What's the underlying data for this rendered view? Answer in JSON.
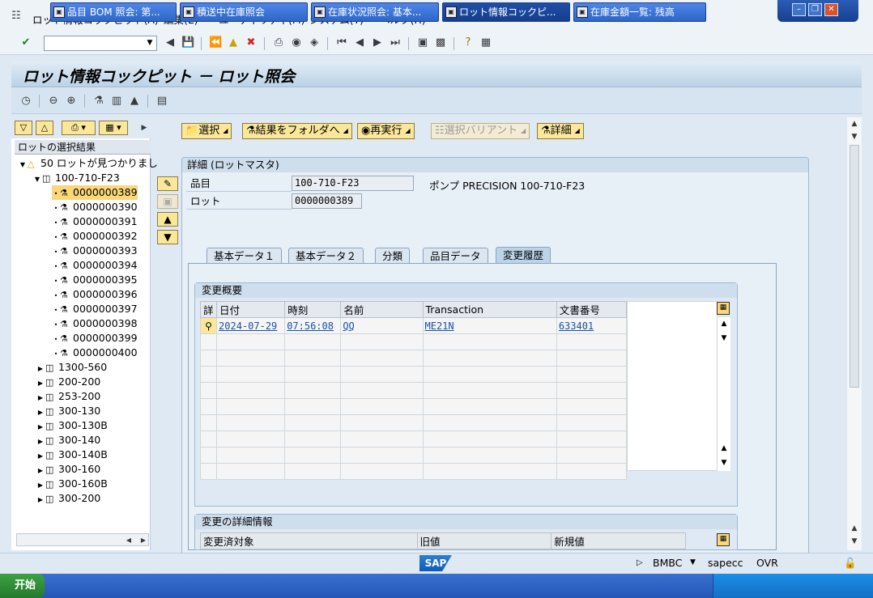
{
  "menu": {
    "items": [
      "ロット情報コックピット(A)",
      "編集(E)",
      "ユーティリティ(M)",
      "システム(Y)",
      "ヘルプ(H)"
    ]
  },
  "title": "ロット情報コックピット － ロット照会",
  "left_panel": {
    "header": "ロットの選択結果",
    "summary": "50 ロットが見つかりまし",
    "material_open": "100-710-F23",
    "lots": [
      "0000000389",
      "0000000390",
      "0000000391",
      "0000000392",
      "0000000393",
      "0000000394",
      "0000000395",
      "0000000396",
      "0000000397",
      "0000000398",
      "0000000399",
      "0000000400"
    ],
    "other_materials": [
      "1300-560",
      "200-200",
      "253-200",
      "300-130",
      "300-130B",
      "300-140",
      "300-140B",
      "300-160",
      "300-160B",
      "300-200"
    ]
  },
  "toolbar": {
    "select": "選択",
    "to_folder": "結果をフォルダへ",
    "rerun": "再実行",
    "select_variant": "選択バリアント",
    "details": "詳細"
  },
  "detail": {
    "header": "詳細 (ロットマスタ)",
    "material_label": "品目",
    "material_value": "100-710-F23",
    "material_desc": "ポンプ PRECISION 100-710-F23",
    "lot_label": "ロット",
    "lot_value": "0000000389"
  },
  "tabs": [
    "基本データ１",
    "基本データ２",
    "分類",
    "品目データ",
    "変更履歴"
  ],
  "change_overview": {
    "title": "変更概要",
    "columns": [
      "詳",
      "日付",
      "時刻",
      "名前",
      "Transaction",
      "文書番号"
    ],
    "rows": [
      {
        "date": "2024-07-29",
        "time": "07:56:08",
        "name": "QQ",
        "transaction": "ME21N",
        "doc": "633401"
      }
    ]
  },
  "change_detail": {
    "title": "変更の詳細情報",
    "columns": [
      "変更済対象",
      "旧値",
      "新規値"
    ]
  },
  "status": {
    "system": "BMBC",
    "server": "sapecc",
    "mode": "OVR"
  },
  "taskbar": {
    "start": "开始",
    "tasks": [
      "品目 BOM 照会: 第...",
      "積送中在庫照会",
      "在庫状況照会: 基本...",
      "ロット情報コックピ...",
      "在庫金額一覧: 残高"
    ]
  }
}
